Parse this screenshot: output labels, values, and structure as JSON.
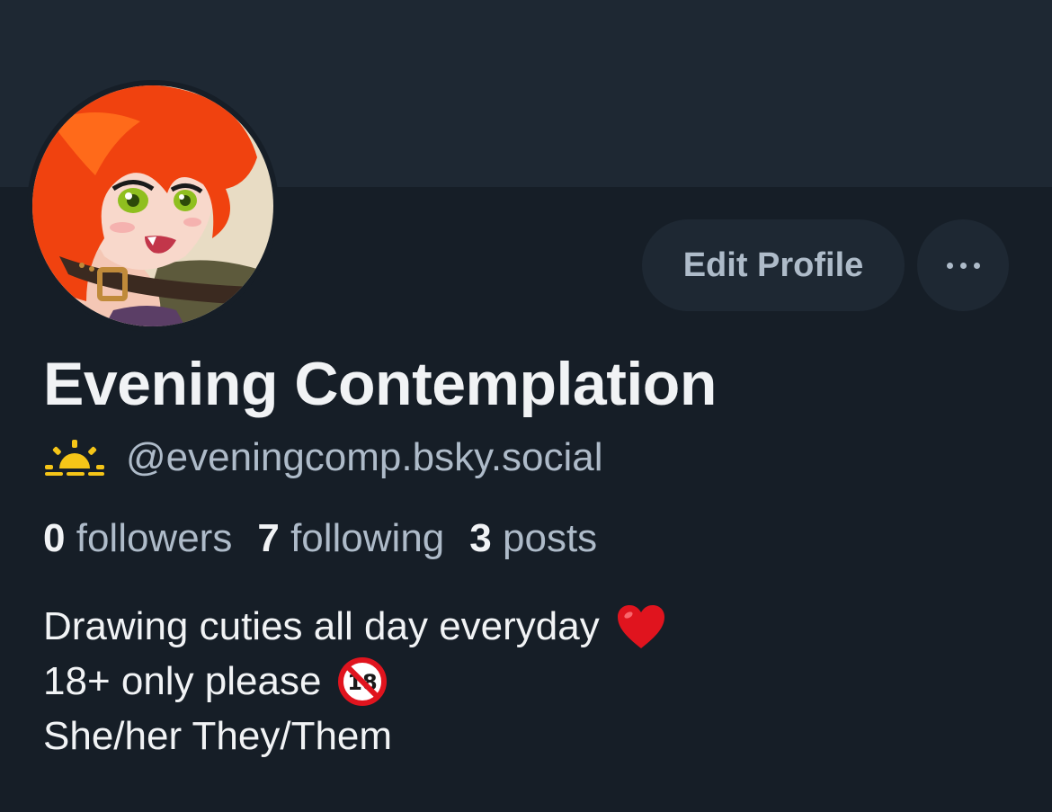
{
  "profile": {
    "display_name": "Evening Contemplation",
    "handle": "@eveningcomp.bsky.social",
    "handle_icon": "sunrise-icon",
    "avatar_icon": "avatar-illustration",
    "edit_button_label": "Edit Profile",
    "more_button_icon": "more-options-icon"
  },
  "stats": [
    {
      "count": "0",
      "label": "followers"
    },
    {
      "count": "7",
      "label": "following"
    },
    {
      "count": "3",
      "label": "posts"
    }
  ],
  "bio": {
    "line1": "Drawing cuties all day everyday",
    "line1_icon": "heart-icon",
    "line2": "18+ only please",
    "line2_icon": "no-under-18-icon",
    "line3": "She/her They/Them"
  },
  "colors": {
    "background": "#161e27",
    "banner": "#1e2833",
    "text_primary": "#f1f3f5",
    "text_secondary": "#aebbc9",
    "button_bg": "#1e2833"
  }
}
